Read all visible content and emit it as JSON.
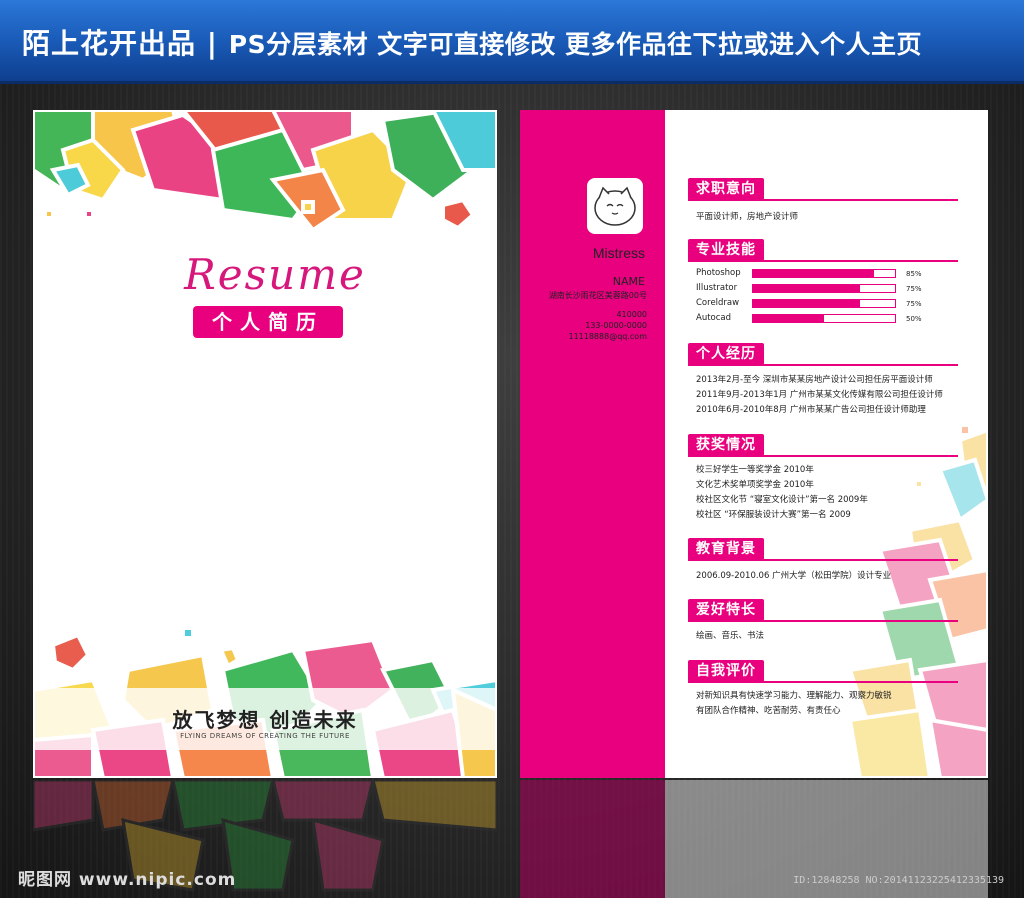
{
  "banner": {
    "title": "陌上花开出品",
    "separator": "|",
    "subtitle": "PS分层素材  文字可直接修改  更多作品往下拉或进入个人主页"
  },
  "left": {
    "script_title": "Resume",
    "badge": "个人简历",
    "slogan": "放飞梦想   创造未来",
    "slogan_en": "FLYING DREAMS OF CREATING THE FUTURE"
  },
  "right": {
    "avatar_icon": "cat-face-icon",
    "name_script": "Mistress",
    "name_label": "NAME",
    "address": "湖南长沙雨花区美蓉路00号",
    "postcode": "410000",
    "phone": "133-0000-0000",
    "email": "11118888@qq.com",
    "sections": {
      "job": {
        "title": "求职意向",
        "lines": [
          "平面设计师，房地产设计师"
        ]
      },
      "skills": {
        "title": "专业技能",
        "items": [
          {
            "name": "Photoshop",
            "percent": 85,
            "label": "85%"
          },
          {
            "name": "Illustrator",
            "percent": 75,
            "label": "75%"
          },
          {
            "name": "Coreldraw",
            "percent": 75,
            "label": "75%"
          },
          {
            "name": "Autocad",
            "percent": 50,
            "label": "50%"
          }
        ]
      },
      "experience": {
        "title": "个人经历",
        "lines": [
          "2013年2月-至今  深圳市某某房地产设计公司担任房平面设计师",
          "2011年9月-2013年1月  广州市某某文化传媒有限公司担任设计师",
          "2010年6月-2010年8月  广州市某某广告公司担任设计师助理"
        ]
      },
      "awards": {
        "title": "获奖情况",
        "lines": [
          "校三好学生一等奖学金  2010年",
          "文化艺术奖单项奖学金  2010年",
          "校社区文化节  “寝室文化设计”第一名 2009年",
          "校社区  “环保服装设计大赛”第一名 2009"
        ]
      },
      "education": {
        "title": "教育背景",
        "lines": [
          "2006.09-2010.06 广州大学（松田学院）设计专业"
        ]
      },
      "hobbies": {
        "title": "爱好特长",
        "lines": [
          "绘画、音乐、书法"
        ]
      },
      "self": {
        "title": "自我评价",
        "lines": [
          "对新知识具有快速学习能力、理解能力、观察力敏锐",
          "有团队合作精神、吃苦耐劳、有责任心"
        ]
      }
    }
  },
  "footer": {
    "logo": "昵图网 www.nipic.com",
    "id": "ID:12848258 NO:20141123225412335139"
  },
  "colors": {
    "accent": "#e8007f",
    "banner": "#1a5bb8"
  }
}
